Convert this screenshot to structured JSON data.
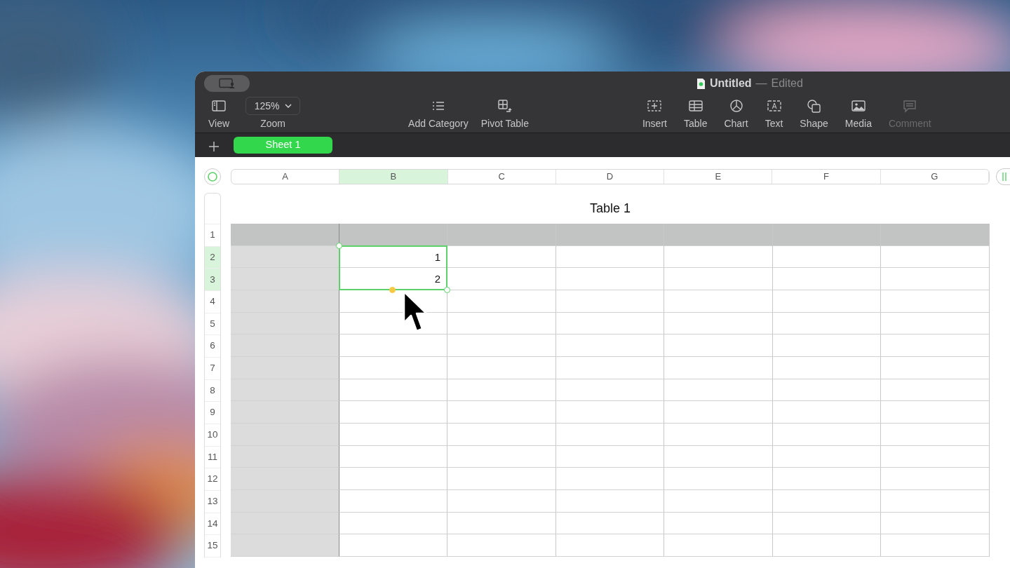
{
  "window": {
    "title": "Untitled",
    "separator": "—",
    "status": "Edited"
  },
  "toolbar": {
    "left": [
      {
        "label": "View",
        "kind": "button",
        "disabled": false
      },
      {
        "label": "Zoom",
        "kind": "dropdown",
        "value": "125%",
        "disabled": false
      }
    ],
    "center": [
      {
        "label": "Add Category",
        "kind": "button",
        "disabled": false
      },
      {
        "label": "Pivot Table",
        "kind": "button",
        "disabled": false
      }
    ],
    "right": [
      {
        "label": "Insert",
        "kind": "button",
        "disabled": false
      },
      {
        "label": "Table",
        "kind": "button",
        "disabled": false
      },
      {
        "label": "Chart",
        "kind": "button",
        "disabled": false
      },
      {
        "label": "Text",
        "kind": "button",
        "icon_text": "A",
        "disabled": false
      },
      {
        "label": "Shape",
        "kind": "button",
        "disabled": false
      },
      {
        "label": "Media",
        "kind": "button",
        "disabled": false
      },
      {
        "label": "Comment",
        "kind": "button",
        "disabled": true
      }
    ]
  },
  "sheet_tabs": [
    {
      "label": "Sheet 1",
      "selected": true
    }
  ],
  "columns": [
    {
      "label": "A",
      "selected": false
    },
    {
      "label": "B",
      "selected": true
    },
    {
      "label": "C",
      "selected": false
    },
    {
      "label": "D",
      "selected": false
    },
    {
      "label": "E",
      "selected": false
    },
    {
      "label": "F",
      "selected": false
    },
    {
      "label": "G",
      "selected": false
    }
  ],
  "table": {
    "title": "Table 1",
    "rows": [
      {
        "label": "1",
        "selected": false,
        "cells": [
          null,
          null,
          null,
          null,
          null,
          null,
          null
        ]
      },
      {
        "label": "2",
        "selected": true,
        "cells": [
          null,
          "1",
          null,
          null,
          null,
          null,
          null
        ]
      },
      {
        "label": "3",
        "selected": true,
        "cells": [
          null,
          "2",
          null,
          null,
          null,
          null,
          null
        ]
      },
      {
        "label": "4",
        "selected": false,
        "cells": [
          null,
          null,
          null,
          null,
          null,
          null,
          null
        ]
      },
      {
        "label": "5",
        "selected": false,
        "cells": [
          null,
          null,
          null,
          null,
          null,
          null,
          null
        ]
      },
      {
        "label": "6",
        "selected": false,
        "cells": [
          null,
          null,
          null,
          null,
          null,
          null,
          null
        ]
      },
      {
        "label": "7",
        "selected": false,
        "cells": [
          null,
          null,
          null,
          null,
          null,
          null,
          null
        ]
      },
      {
        "label": "8",
        "selected": false,
        "cells": [
          null,
          null,
          null,
          null,
          null,
          null,
          null
        ]
      },
      {
        "label": "9",
        "selected": false,
        "cells": [
          null,
          null,
          null,
          null,
          null,
          null,
          null
        ]
      },
      {
        "label": "10",
        "selected": false,
        "cells": [
          null,
          null,
          null,
          null,
          null,
          null,
          null
        ]
      },
      {
        "label": "11",
        "selected": false,
        "cells": [
          null,
          null,
          null,
          null,
          null,
          null,
          null
        ]
      },
      {
        "label": "12",
        "selected": false,
        "cells": [
          null,
          null,
          null,
          null,
          null,
          null,
          null
        ]
      },
      {
        "label": "13",
        "selected": false,
        "cells": [
          null,
          null,
          null,
          null,
          null,
          null,
          null
        ]
      },
      {
        "label": "14",
        "selected": false,
        "cells": [
          null,
          null,
          null,
          null,
          null,
          null,
          null
        ]
      },
      {
        "label": "15",
        "selected": false,
        "cells": [
          null,
          null,
          null,
          null,
          null,
          null,
          null
        ]
      }
    ]
  }
}
